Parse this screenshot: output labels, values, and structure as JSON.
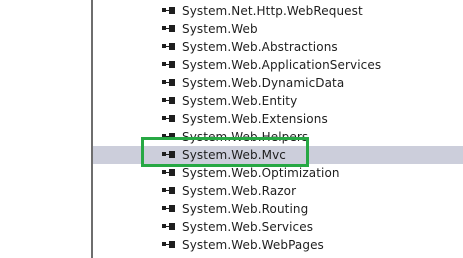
{
  "references": [
    {
      "label": "System.Net.Http.WebRequest",
      "icon": "assembly-reference-icon"
    },
    {
      "label": "System.Web",
      "icon": "assembly-reference-icon"
    },
    {
      "label": "System.Web.Abstractions",
      "icon": "assembly-reference-icon"
    },
    {
      "label": "System.Web.ApplicationServices",
      "icon": "assembly-reference-icon"
    },
    {
      "label": "System.Web.DynamicData",
      "icon": "assembly-reference-icon"
    },
    {
      "label": "System.Web.Entity",
      "icon": "assembly-reference-icon"
    },
    {
      "label": "System.Web.Extensions",
      "icon": "assembly-reference-icon"
    },
    {
      "label": "System.Web.Helpers",
      "icon": "assembly-reference-icon"
    },
    {
      "label": "System.Web.Mvc",
      "icon": "assembly-reference-icon",
      "selected": true
    },
    {
      "label": "System.Web.Optimization",
      "icon": "assembly-reference-icon"
    },
    {
      "label": "System.Web.Razor",
      "icon": "assembly-reference-icon"
    },
    {
      "label": "System.Web.Routing",
      "icon": "assembly-reference-icon"
    },
    {
      "label": "System.Web.Services",
      "icon": "assembly-reference-icon"
    },
    {
      "label": "System.Web.WebPages",
      "icon": "assembly-reference-icon"
    }
  ],
  "colors": {
    "selection_background": "#cccedb",
    "highlight_border": "#27a844",
    "text": "#1e1e1e"
  }
}
